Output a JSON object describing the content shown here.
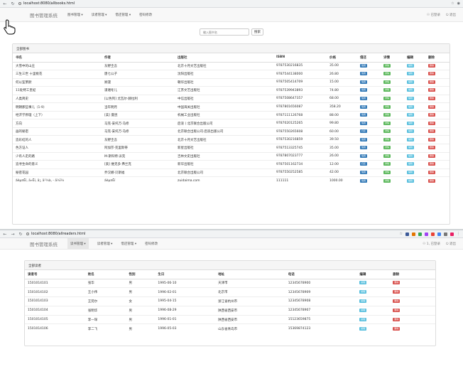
{
  "top": {
    "url": "localhost:8080/allbooks.html",
    "brand": "图书管理系统",
    "menus": [
      "图书管理 ▾",
      "读者管理 ▾",
      "借还管理 ▾",
      "密码修改"
    ],
    "right": [
      "⚇ 已登录",
      "⏻ 退出"
    ],
    "search_placeholder": "输入图书名",
    "search_button": "搜索",
    "panel_title": "全部图书",
    "columns": [
      "书名",
      "作者",
      "出版社",
      "ISBN",
      "价格",
      "借还",
      "详情",
      "编辑",
      "删除"
    ],
    "rows": [
      [
        "大雪中的山庄",
        "东野圭吾",
        "北京十月文艺出版社",
        "9787530216835",
        "35.00",
        "借阅"
      ],
      [
        "三生三世 十里桃花",
        "唐七公子",
        "沈阳出版社",
        "9787544138000",
        "26.80",
        "借阅"
      ],
      [
        "何以笙箫默",
        "顾漫",
        "朝华出版社",
        "9787505414709",
        "15.00",
        "借阅"
      ],
      [
        "11处特工皇妃",
        "潇湘冬儿",
        "江苏文艺出版社",
        "9787539943893",
        "74.80",
        "借阅"
      ],
      [
        "人类简史",
        "[以色列] 尤瓦尔·赫拉利",
        "中信出版社",
        "9787508647357",
        "68.00",
        "借阅"
      ],
      [
        "明朝那些事儿（1-9）",
        "当年明月",
        "中国海关出版社",
        "9787801656087",
        "358.20",
        "借阅"
      ],
      [
        "经济学原理（上下）",
        "[美] 曼昆",
        "机械工业出版社",
        "9787111126768",
        "88.00",
        "借阅"
      ],
      [
        "方向",
        "马克-安托万·马修",
        "后浪丨北京联合出版公司",
        "9787020125265",
        "99.80",
        "借阅"
      ],
      [
        "画的秘密",
        "马克-安托万·马修",
        "北京联合出版公司·后浪出版公司",
        "9787550265608",
        "60.00",
        "归还"
      ],
      [
        "造彩虹的人",
        "东野圭吾",
        "北京十月文艺出版社",
        "9787530216859",
        "39.50",
        "借阅"
      ],
      [
        "色方证人",
        "阿加莎·克里斯蒂",
        "新星出版社",
        "9787513325745",
        "35.00",
        "借阅"
      ],
      [
        "少有人走的路",
        "M·斯科特·派克",
        "吉林文史出版社",
        "9787807023777",
        "26.00",
        "借阅"
      ],
      [
        "追寻生命的意义",
        "[奥] 维克多·弗兰克",
        "新华出版社",
        "9787501162734",
        "12.00",
        "归还"
      ],
      [
        "秘密花园",
        "乔汉娜·贝斯福",
        "北京联合出版公司",
        "9787550252585",
        "42.00",
        "借阅"
      ],
      [
        "âèµ¤Ëí, ä»Ëí, ä¦, ä¹¼à, - ä½ï¼",
        "âèµ¤Ëí",
        "zuidaima.com",
        "111111",
        "1000.00",
        "借阅"
      ]
    ],
    "buttons": {
      "detail": "详情",
      "edit": "编辑",
      "delete": "删除"
    }
  },
  "bottom": {
    "url": "localhost:8080/allreaders.html",
    "brand": "图书管理系统",
    "menus": [
      "读书管理 ▾",
      "读者管理 ▾",
      "借还管理 ▾",
      "密码修改"
    ],
    "right": [
      "⚇ 1, 已登录",
      "⏻ 退出"
    ],
    "panel_title": "全部读者",
    "columns": [
      "读者号",
      "姓名",
      "性别",
      "生日",
      "地址",
      "电话",
      "编辑",
      "删除"
    ],
    "rows": [
      [
        "1501014101",
        "张华",
        "男",
        "1995-06-10",
        "天津市",
        "12345678900"
      ],
      [
        "1501014102",
        "王小伟",
        "男",
        "1996-02-01",
        "北京市",
        "12345678909"
      ],
      [
        "1501014103",
        "王莞尔",
        "女",
        "1995-04-15",
        "浙江省杭州市",
        "12345678908"
      ],
      [
        "1501014104",
        "张明华",
        "男",
        "1996-08-29",
        "陕西省西安市",
        "12345678907"
      ],
      [
        "1501014105",
        "李一琛",
        "男",
        "1996-01-01",
        "陕西省西安市",
        "15123659875"
      ],
      [
        "1501014106",
        "李二飞",
        "男",
        "1996-05-03",
        "山东省青岛市",
        "15369874123"
      ]
    ],
    "buttons": {
      "edit": "编辑",
      "delete": "删除"
    }
  },
  "colors": {
    "blue": "#337ab7",
    "green": "#5cb85c",
    "cyan": "#5bc0de",
    "red": "#d9534f"
  }
}
